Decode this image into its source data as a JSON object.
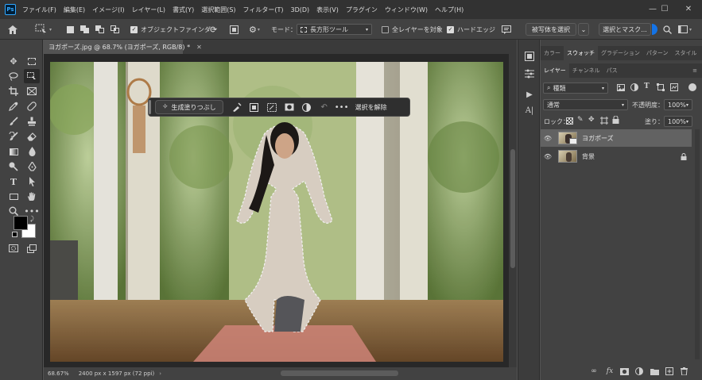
{
  "menu": {
    "app_badge": "Ps",
    "items": [
      "ファイル(F)",
      "編集(E)",
      "イメージ(I)",
      "レイヤー(L)",
      "書式(Y)",
      "選択範囲(S)",
      "フィルター(T)",
      "3D(D)",
      "表示(V)",
      "プラグイン",
      "ウィンドウ(W)",
      "ヘルプ(H)"
    ],
    "window_controls": [
      "—",
      "☐",
      "✕"
    ]
  },
  "options": {
    "object_finder_label": "オブジェクトファインダー",
    "object_finder_checked": true,
    "mode_label": "モード：",
    "mode_value": "長方形ツール",
    "all_layers_label": "全レイヤーを対象",
    "all_layers_checked": false,
    "hard_edge_label": "ハードエッジ",
    "hard_edge_checked": true,
    "select_subject_label": "被写体を選択",
    "select_and_mask_label": "選択とマスク..."
  },
  "document": {
    "tab_title": "ヨガポーズ.jpg @ 68.7% (ヨガポーズ, RGB/8) *",
    "zoom": "68.67%",
    "dimensions": "2400 px x 1597 px (72 ppi)"
  },
  "taskbar": {
    "generative_fill_label": "生成塗りつぶし",
    "deselect_label": "選択を解除"
  },
  "panels": {
    "top_tabs": [
      "カラー",
      "スウォッチ",
      "グラデーション",
      "パターン",
      "スタイル"
    ],
    "top_active": 1,
    "layer_tabs": [
      "レイヤー",
      "チャンネル",
      "パス"
    ],
    "layer_active": 0,
    "filter_kind": "種類",
    "blend_mode": "通常",
    "opacity_label": "不透明度：",
    "opacity_value": "100%",
    "lock_label": "ロック：",
    "fill_label": "塗り：",
    "fill_value": "100%",
    "layers": [
      {
        "name": "ヨガポーズ",
        "selected": true,
        "locked": false
      },
      {
        "name": "背景",
        "selected": false,
        "locked": true
      }
    ]
  },
  "colors": {
    "accent": "#1473e6",
    "foreground": "#000000",
    "background": "#ffffff"
  }
}
